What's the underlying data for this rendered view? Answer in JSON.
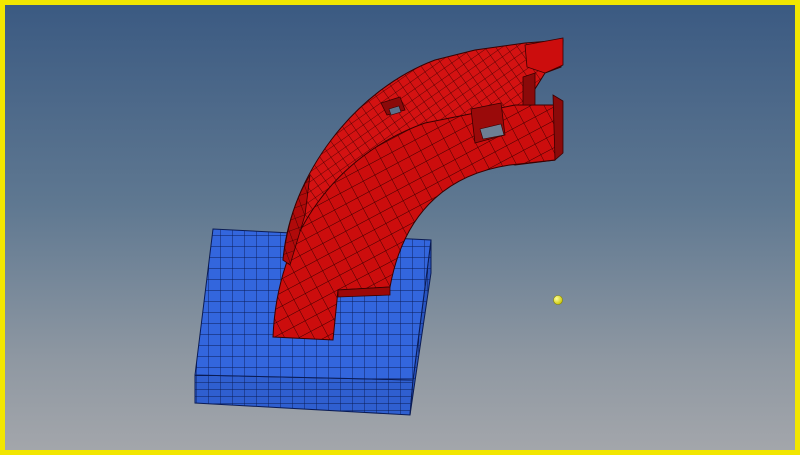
{
  "viewport": {
    "border_color": "#f2e600",
    "background_top": "#3b5a82",
    "background_bottom": "#a3a6ab"
  },
  "model": {
    "base_block": {
      "color": "#3366dd",
      "mesh_color": "#0b1c55"
    },
    "curved_part": {
      "color": "#cc0d0d",
      "mesh_color": "#3a0000"
    },
    "pivot_marker": {
      "color": "#ecec22"
    }
  }
}
